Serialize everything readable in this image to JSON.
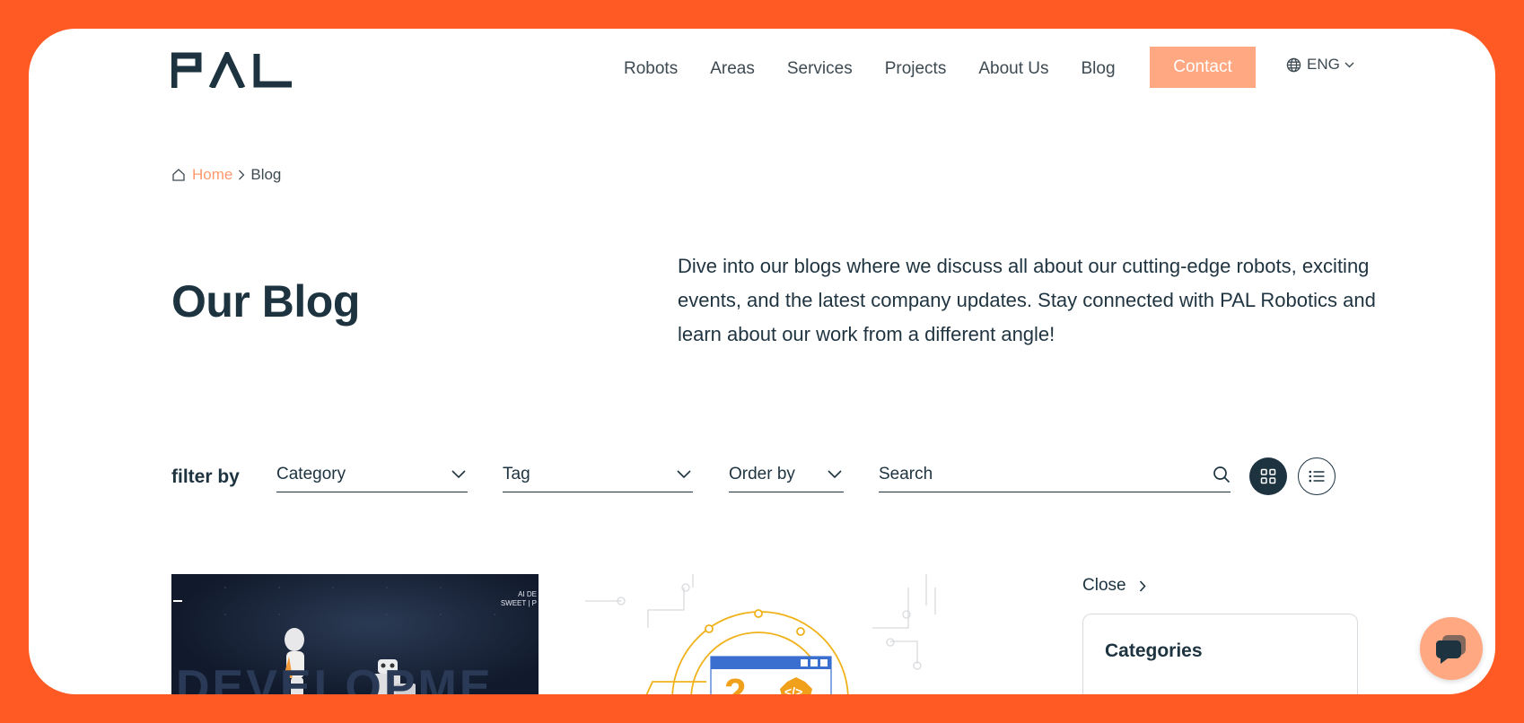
{
  "header": {
    "logo_text": "PAL",
    "nav": [
      "Robots",
      "Areas",
      "Services",
      "Projects",
      "About Us",
      "Blog"
    ],
    "contact_label": "Contact",
    "language": "ENG"
  },
  "breadcrumb": {
    "home": "Home",
    "current": "Blog"
  },
  "hero": {
    "title": "Our Blog",
    "intro": "Dive into our blogs where we discuss all about our cutting-edge robots, exciting events, and the latest company updates. Stay connected with PAL Robotics and learn about our work from a different angle!"
  },
  "filters": {
    "label": "filter by",
    "category": "Category",
    "tag": "Tag",
    "order_by": "Order by",
    "search_placeholder": "Search"
  },
  "cards": [
    {
      "image_text": "DEVELOPME",
      "corner_text_1": "AI DE",
      "corner_text_2": "SWEET | P"
    },
    {
      "image_text": "2"
    }
  ],
  "sidebar": {
    "close_label": "Close",
    "categories_title": "Categories"
  },
  "colors": {
    "brand_orange": "#ff5a23",
    "contact_button": "#ffa882",
    "dark_text": "#1d3340"
  }
}
